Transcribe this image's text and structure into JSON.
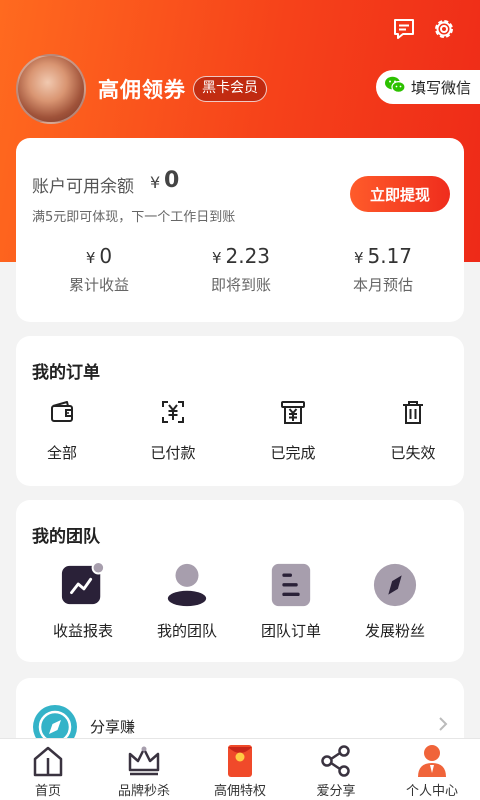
{
  "header": {
    "message_icon": "message-icon",
    "settings_icon": "gear-icon",
    "user_name": "高佣领券",
    "vip_badge": "黑卡会员",
    "wechat_button": "填写微信"
  },
  "balance": {
    "label": "账户可用余额",
    "currency": "¥",
    "value": "0",
    "hint": "满5元即可体现，下一个工作日到账",
    "withdraw_button": "立即提现",
    "stats": [
      {
        "currency": "¥",
        "value": "0",
        "label": "累计收益"
      },
      {
        "currency": "¥",
        "value": "2.23",
        "label": "即将到账"
      },
      {
        "currency": "¥",
        "value": "5.17",
        "label": "本月预估"
      }
    ]
  },
  "orders": {
    "title": "我的订单",
    "items": [
      {
        "label": "全部",
        "icon": "wallet-icon"
      },
      {
        "label": "已付款",
        "icon": "paid-icon"
      },
      {
        "label": "已完成",
        "icon": "receipt-icon"
      },
      {
        "label": "已失效",
        "icon": "trash-icon"
      }
    ]
  },
  "team": {
    "title": "我的团队",
    "items": [
      {
        "label": "收益报表",
        "icon": "chart-icon"
      },
      {
        "label": "我的团队",
        "icon": "person-icon"
      },
      {
        "label": "团队订单",
        "icon": "list-icon"
      },
      {
        "label": "发展粉丝",
        "icon": "compass-icon"
      }
    ]
  },
  "share": {
    "label": "分享赚",
    "icon": "compass-icon",
    "chevron": "chevron-right-icon"
  },
  "nav": {
    "items": [
      {
        "label": "首页",
        "icon": "home-icon"
      },
      {
        "label": "品牌秒杀",
        "icon": "crown-icon"
      },
      {
        "label": "高佣特权",
        "icon": "red-envelope-icon"
      },
      {
        "label": "爱分享",
        "icon": "share-icon"
      },
      {
        "label": "个人中心",
        "icon": "profile-icon"
      }
    ]
  },
  "colors": {
    "brand_red": "#ef2d1d",
    "brand_orange": "#ff6a1f",
    "dark_icon": "#2a2138",
    "gray_icon": "#a79ead"
  }
}
